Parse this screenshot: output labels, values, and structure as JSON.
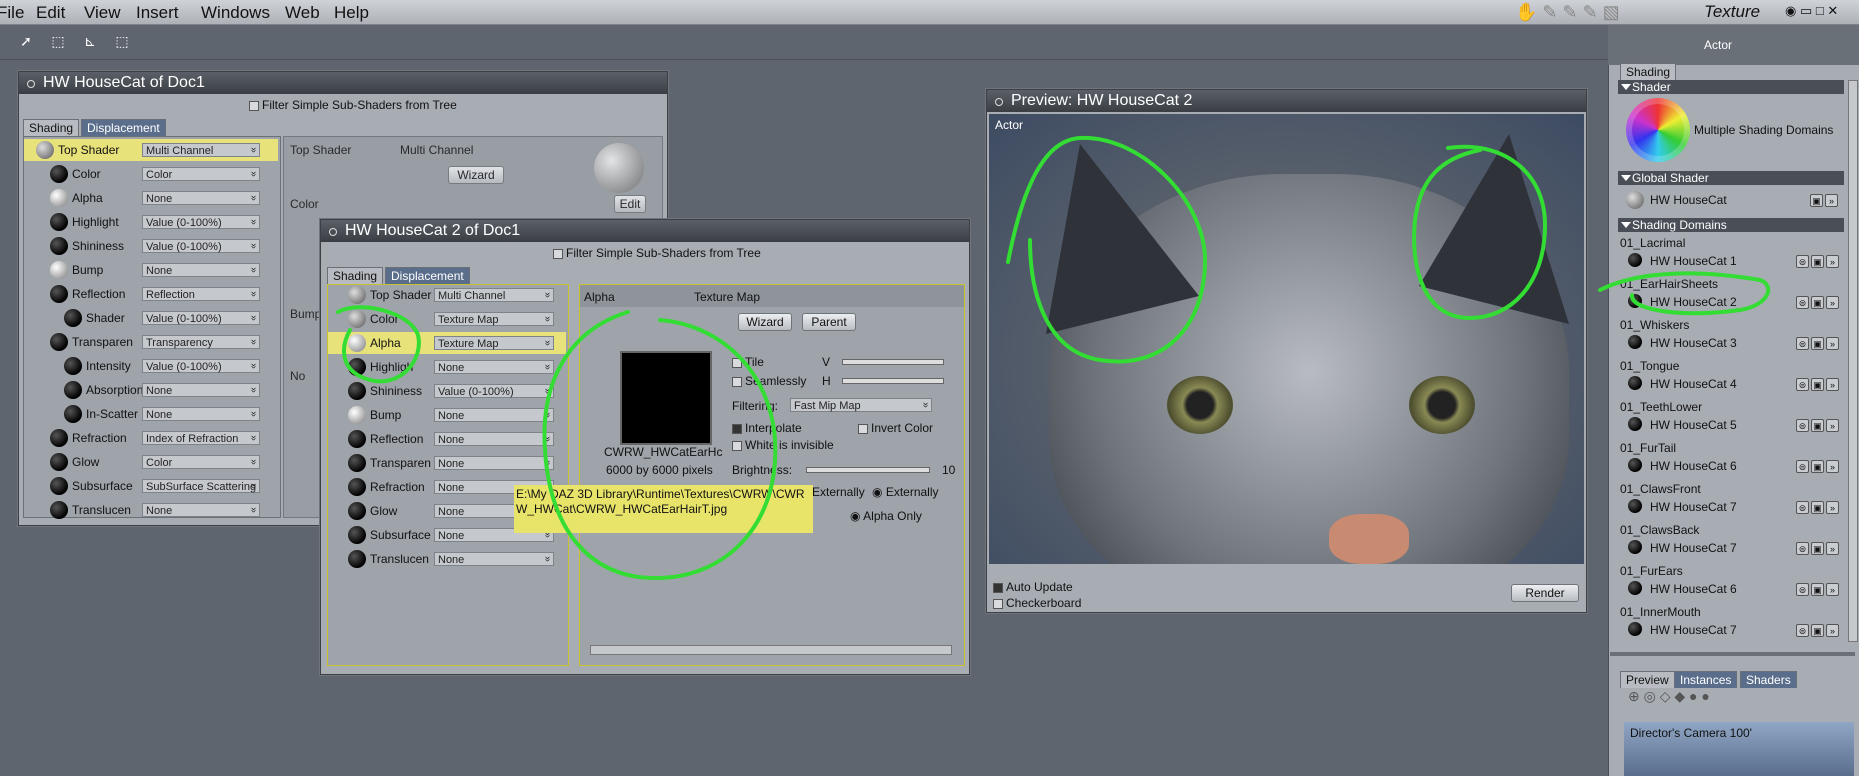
{
  "menu": [
    "File",
    "Edit",
    "View",
    "Insert",
    "Windows",
    "Web",
    "Help"
  ],
  "room": {
    "name": "Texture",
    "panel_title": "Actor"
  },
  "win1": {
    "title": "HW HouseCat of Doc1",
    "filter_label": "Filter Simple Sub-Shaders from Tree",
    "tabs": [
      "Shading",
      "Displacement"
    ],
    "tree": [
      {
        "label": "Top Shader",
        "value": "Multi Channel"
      },
      {
        "label": "Color",
        "value": "Color"
      },
      {
        "label": "Alpha",
        "value": "None"
      },
      {
        "label": "Highlight",
        "value": "Value (0-100%)"
      },
      {
        "label": "Shininess",
        "value": "Value (0-100%)"
      },
      {
        "label": "Bump",
        "value": "None"
      },
      {
        "label": "Reflection",
        "value": "Reflection"
      },
      {
        "label": "Shader",
        "value": "Value (0-100%)"
      },
      {
        "label": "Transparen",
        "value": "Transparency"
      },
      {
        "label": "Intensity",
        "value": "Value (0-100%)"
      },
      {
        "label": "Absorption",
        "value": "None"
      },
      {
        "label": "In-Scatter",
        "value": "None"
      },
      {
        "label": "Refraction",
        "value": "Index of Refraction"
      },
      {
        "label": "Glow",
        "value": "Color"
      },
      {
        "label": "Subsurface",
        "value": "SubSurface Scattering"
      },
      {
        "label": "Translucen",
        "value": "None"
      }
    ],
    "detail": {
      "title": "Top Shader",
      "type": "Multi Channel",
      "wizard": "Wizard",
      "color_label": "Color",
      "edit": "Edit",
      "bump_label": "Bump",
      "no_label": "No"
    }
  },
  "win2": {
    "title": "HW HouseCat 2 of Doc1",
    "filter_label": "Filter Simple Sub-Shaders from Tree",
    "tabs": [
      "Shading",
      "Displacement"
    ],
    "tree": [
      {
        "label": "Top Shader",
        "value": "Multi Channel"
      },
      {
        "label": "Color",
        "value": "Texture Map"
      },
      {
        "label": "Alpha",
        "value": "Texture Map"
      },
      {
        "label": "Highligh",
        "value": "None"
      },
      {
        "label": "Shininess",
        "value": "Value (0-100%)"
      },
      {
        "label": "Bump",
        "value": "None"
      },
      {
        "label": "Reflection",
        "value": "None"
      },
      {
        "label": "Transparen",
        "value": "None"
      },
      {
        "label": "Refraction",
        "value": "None"
      },
      {
        "label": "Glow",
        "value": "None"
      },
      {
        "label": "Subsurface",
        "value": "None"
      },
      {
        "label": "Translucen",
        "value": "None"
      }
    ],
    "detail": {
      "channel": "Alpha",
      "type": "Texture Map",
      "wizard": "Wizard",
      "parent": "Parent",
      "tile": "Tile",
      "seamlessly": "Seamlessly",
      "v": "V",
      "h": "H",
      "filtering_label": "Filtering:",
      "filtering_value": "Fast Mip Map",
      "interpolate": "Interpolate",
      "invert": "Invert Color",
      "white_invisible": "White is invisible",
      "brightness_label": "Brightness:",
      "brightness_value": "10",
      "texture_name": "CWRW_HWCatEarHc",
      "texture_size": "6000 by 6000 pixels",
      "externally": "Externally",
      "externally2": "Externally",
      "alpha_only": "Alpha Only",
      "tooltip": "E:\\My DAZ 3D Library\\Runtime\\Textures\\CWRW\\CWRW_HWCat\\CWRW_HWCatEarHairT.jpg"
    }
  },
  "preview": {
    "title": "Preview: HW HouseCat 2",
    "actor": "Actor",
    "auto_update": "Auto Update",
    "checkerboard": "Checkerboard",
    "render": "Render"
  },
  "right_panel": {
    "tab": "Shading",
    "shader_section": "Shader",
    "multiple_domains": "Multiple Shading Domains",
    "global_section": "Global Shader",
    "global_name": "HW HouseCat",
    "domains_section": "Shading Domains",
    "domains": [
      {
        "domain": "01_Lacrimal",
        "shader": "HW HouseCat 1"
      },
      {
        "domain": "01_EarHairSheets",
        "shader": "HW HouseCat 2"
      },
      {
        "domain": "01_Whiskers",
        "shader": "HW HouseCat 3"
      },
      {
        "domain": "01_Tongue",
        "shader": "HW HouseCat 4"
      },
      {
        "domain": "01_TeethLower",
        "shader": "HW HouseCat 5"
      },
      {
        "domain": "01_FurTail",
        "shader": "HW HouseCat 6"
      },
      {
        "domain": "01_ClawsFront",
        "shader": "HW HouseCat 7"
      },
      {
        "domain": "01_ClawsBack",
        "shader": "HW HouseCat 7"
      },
      {
        "domain": "01_FurEars",
        "shader": "HW HouseCat 6"
      },
      {
        "domain": "01_InnerMouth",
        "shader": "HW HouseCat 7"
      }
    ],
    "bottom_tabs": [
      "Preview",
      "Instances",
      "Shaders"
    ],
    "camera": "Director's Camera 100'"
  }
}
